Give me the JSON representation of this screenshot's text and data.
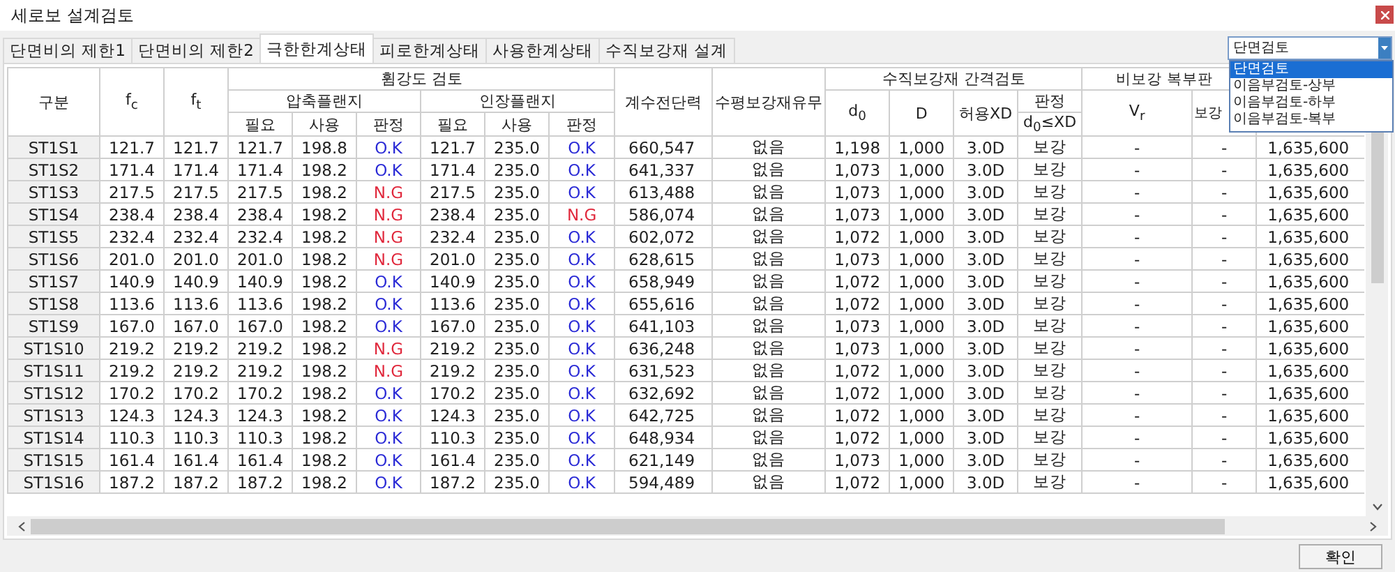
{
  "window": {
    "title": "세로보 설계검토"
  },
  "tabs": [
    {
      "label": "단면비의 제한1",
      "selected": false
    },
    {
      "label": "단면비의 제한2",
      "selected": false
    },
    {
      "label": "극한한계상태",
      "selected": true
    },
    {
      "label": "피로한계상태",
      "selected": false
    },
    {
      "label": "사용한계상태",
      "selected": false
    },
    {
      "label": "수직보강재 설계",
      "selected": false
    }
  ],
  "dropdown": {
    "value": "단면검토",
    "expanded": true,
    "options": [
      {
        "label": "단면검토",
        "selected": true
      },
      {
        "label": "이음부검토-상부",
        "selected": false
      },
      {
        "label": "이음부검토-하부",
        "selected": false
      },
      {
        "label": "이음부검토-복부",
        "selected": false
      }
    ]
  },
  "table": {
    "header_rows": [
      [
        {
          "label": "구분",
          "rowspan": 3
        },
        {
          "label": "f$_{c}$",
          "rowspan": 3
        },
        {
          "label": "f$_{t}$",
          "rowspan": 3
        },
        {
          "label": "휨강도 검토",
          "colspan": 6
        },
        {
          "label": "계수전단력",
          "rowspan": 3
        },
        {
          "label": "수평보강재유무",
          "rowspan": 3
        },
        {
          "label": "수직보강재 간격검토",
          "colspan": 4
        },
        {
          "label": "비보강 복부판",
          "colspan": 3
        }
      ],
      [
        {
          "label": "압축플랜지",
          "colspan": 3
        },
        {
          "label": "인장플랜지",
          "colspan": 3
        },
        {
          "label": "d$_{0}$",
          "rowspan": 2
        },
        {
          "label": "D",
          "rowspan": 2
        },
        {
          "label": "허용XD",
          "rowspan": 2
        },
        {
          "label": "판정"
        },
        {
          "label": "V$_{r}$",
          "rowspan": 2
        },
        {
          "label": "보강",
          "rowspan": 2
        }
      ],
      [
        {
          "label": "필요"
        },
        {
          "label": "사용"
        },
        {
          "label": "판정"
        },
        {
          "label": "필요"
        },
        {
          "label": "사용"
        },
        {
          "label": "판정"
        },
        {
          "label": "d$_{0}$≤XD"
        }
      ]
    ],
    "rows": [
      {
        "cells": [
          "ST1S1",
          "121.7",
          "121.7",
          "121.7",
          "198.8",
          {
            "text": "O.K",
            "pass": true
          },
          "121.7",
          "235.0",
          {
            "text": "O.K",
            "pass": true
          },
          "660,547",
          "없음",
          "1,198",
          "1,000",
          "3.0D",
          "보강",
          "-",
          "-",
          "1,635,600"
        ]
      },
      {
        "cells": [
          "ST1S2",
          "171.4",
          "171.4",
          "171.4",
          "198.2",
          {
            "text": "O.K",
            "pass": true
          },
          "171.4",
          "235.0",
          {
            "text": "O.K",
            "pass": true
          },
          "641,337",
          "없음",
          "1,073",
          "1,000",
          "3.0D",
          "보강",
          "-",
          "-",
          "1,635,600"
        ]
      },
      {
        "cells": [
          "ST1S3",
          "217.5",
          "217.5",
          "217.5",
          "198.2",
          {
            "text": "N.G",
            "pass": false
          },
          "217.5",
          "235.0",
          {
            "text": "O.K",
            "pass": true
          },
          "613,488",
          "없음",
          "1,073",
          "1,000",
          "3.0D",
          "보강",
          "-",
          "-",
          "1,635,600"
        ]
      },
      {
        "cells": [
          "ST1S4",
          "238.4",
          "238.4",
          "238.4",
          "198.2",
          {
            "text": "N.G",
            "pass": false
          },
          "238.4",
          "235.0",
          {
            "text": "N.G",
            "pass": false
          },
          "586,074",
          "없음",
          "1,073",
          "1,000",
          "3.0D",
          "보강",
          "-",
          "-",
          "1,635,600"
        ]
      },
      {
        "cells": [
          "ST1S5",
          "232.4",
          "232.4",
          "232.4",
          "198.2",
          {
            "text": "N.G",
            "pass": false
          },
          "232.4",
          "235.0",
          {
            "text": "O.K",
            "pass": true
          },
          "602,072",
          "없음",
          "1,072",
          "1,000",
          "3.0D",
          "보강",
          "-",
          "-",
          "1,635,600"
        ]
      },
      {
        "cells": [
          "ST1S6",
          "201.0",
          "201.0",
          "201.0",
          "198.2",
          {
            "text": "N.G",
            "pass": false
          },
          "201.0",
          "235.0",
          {
            "text": "O.K",
            "pass": true
          },
          "628,615",
          "없음",
          "1,073",
          "1,000",
          "3.0D",
          "보강",
          "-",
          "-",
          "1,635,600"
        ]
      },
      {
        "cells": [
          "ST1S7",
          "140.9",
          "140.9",
          "140.9",
          "198.2",
          {
            "text": "O.K",
            "pass": true
          },
          "140.9",
          "235.0",
          {
            "text": "O.K",
            "pass": true
          },
          "658,949",
          "없음",
          "1,072",
          "1,000",
          "3.0D",
          "보강",
          "-",
          "-",
          "1,635,600"
        ]
      },
      {
        "cells": [
          "ST1S8",
          "113.6",
          "113.6",
          "113.6",
          "198.2",
          {
            "text": "O.K",
            "pass": true
          },
          "113.6",
          "235.0",
          {
            "text": "O.K",
            "pass": true
          },
          "655,616",
          "없음",
          "1,072",
          "1,000",
          "3.0D",
          "보강",
          "-",
          "-",
          "1,635,600"
        ]
      },
      {
        "cells": [
          "ST1S9",
          "167.0",
          "167.0",
          "167.0",
          "198.2",
          {
            "text": "O.K",
            "pass": true
          },
          "167.0",
          "235.0",
          {
            "text": "O.K",
            "pass": true
          },
          "641,103",
          "없음",
          "1,073",
          "1,000",
          "3.0D",
          "보강",
          "-",
          "-",
          "1,635,600"
        ]
      },
      {
        "cells": [
          "ST1S10",
          "219.2",
          "219.2",
          "219.2",
          "198.2",
          {
            "text": "N.G",
            "pass": false
          },
          "219.2",
          "235.0",
          {
            "text": "O.K",
            "pass": true
          },
          "636,248",
          "없음",
          "1,073",
          "1,000",
          "3.0D",
          "보강",
          "-",
          "-",
          "1,635,600"
        ]
      },
      {
        "cells": [
          "ST1S11",
          "219.2",
          "219.2",
          "219.2",
          "198.2",
          {
            "text": "N.G",
            "pass": false
          },
          "219.2",
          "235.0",
          {
            "text": "O.K",
            "pass": true
          },
          "631,523",
          "없음",
          "1,072",
          "1,000",
          "3.0D",
          "보강",
          "-",
          "-",
          "1,635,600"
        ]
      },
      {
        "cells": [
          "ST1S12",
          "170.2",
          "170.2",
          "170.2",
          "198.2",
          {
            "text": "O.K",
            "pass": true
          },
          "170.2",
          "235.0",
          {
            "text": "O.K",
            "pass": true
          },
          "632,692",
          "없음",
          "1,072",
          "1,000",
          "3.0D",
          "보강",
          "-",
          "-",
          "1,635,600"
        ]
      },
      {
        "cells": [
          "ST1S13",
          "124.3",
          "124.3",
          "124.3",
          "198.2",
          {
            "text": "O.K",
            "pass": true
          },
          "124.3",
          "235.0",
          {
            "text": "O.K",
            "pass": true
          },
          "642,725",
          "없음",
          "1,072",
          "1,000",
          "3.0D",
          "보강",
          "-",
          "-",
          "1,635,600"
        ]
      },
      {
        "cells": [
          "ST1S14",
          "110.3",
          "110.3",
          "110.3",
          "198.2",
          {
            "text": "O.K",
            "pass": true
          },
          "110.3",
          "235.0",
          {
            "text": "O.K",
            "pass": true
          },
          "648,934",
          "없음",
          "1,072",
          "1,000",
          "3.0D",
          "보강",
          "-",
          "-",
          "1,635,600"
        ]
      },
      {
        "cells": [
          "ST1S15",
          "161.4",
          "161.4",
          "161.4",
          "198.2",
          {
            "text": "O.K",
            "pass": true
          },
          "161.4",
          "235.0",
          {
            "text": "O.K",
            "pass": true
          },
          "621,149",
          "없음",
          "1,073",
          "1,000",
          "3.0D",
          "보강",
          "-",
          "-",
          "1,635,600"
        ]
      },
      {
        "cells": [
          "ST1S16",
          "187.2",
          "187.2",
          "187.2",
          "198.2",
          {
            "text": "O.K",
            "pass": true
          },
          "187.2",
          "235.0",
          {
            "text": "O.K",
            "pass": true
          },
          "594,489",
          "없음",
          "1,072",
          "1,000",
          "3.0D",
          "보강",
          "-",
          "-",
          "1,635,600"
        ]
      }
    ]
  },
  "buttons": [
    {
      "label": "확인"
    }
  ]
}
